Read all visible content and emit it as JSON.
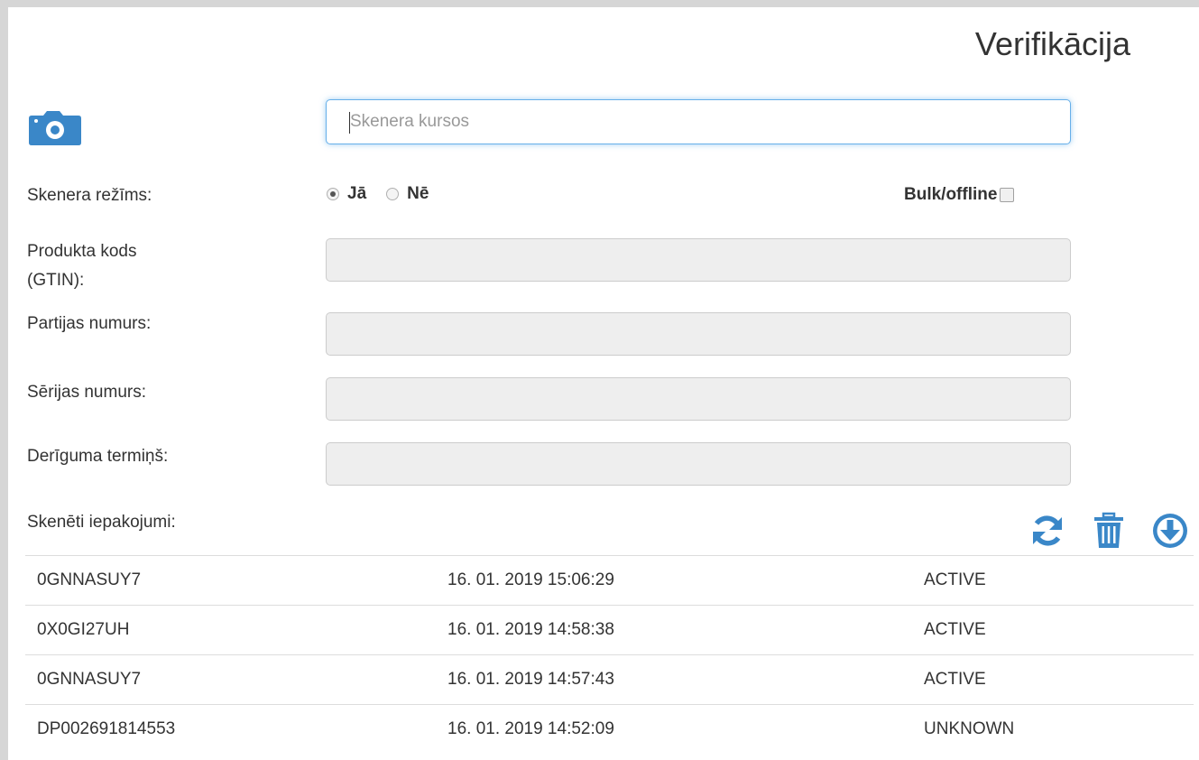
{
  "page": {
    "title": "Verifikācija"
  },
  "scanner": {
    "camera_icon": "camera-icon",
    "cursor_placeholder": "Skenera kursos"
  },
  "mode": {
    "label": "Skenera režīms:",
    "options": [
      {
        "label": "Jā",
        "selected": true
      },
      {
        "label": "Nē",
        "selected": false
      }
    ],
    "bulk_label": "Bulk/offline",
    "bulk_checked": false
  },
  "fields": [
    {
      "label_line1": "Produkta kods",
      "label_line2": "(GTIN):",
      "value": ""
    },
    {
      "label_line1": "Partijas numurs:",
      "value": ""
    },
    {
      "label_line1": "Sērijas numurs:",
      "value": ""
    },
    {
      "label_line1": "Derīguma termiņš:",
      "value": ""
    }
  ],
  "packages": {
    "label": "Skenēti iepakojumi:",
    "icons": [
      "refresh-icon",
      "trash-icon",
      "download-icon"
    ],
    "rows": [
      {
        "code": "0GNNASUY7",
        "datetime": "16. 01. 2019 15:06:29",
        "status": "ACTIVE"
      },
      {
        "code": "0X0GI27UH",
        "datetime": "16. 01. 2019 14:58:38",
        "status": "ACTIVE"
      },
      {
        "code": "0GNNASUY7",
        "datetime": "16. 01. 2019 14:57:43",
        "status": "ACTIVE"
      },
      {
        "code": "DP002691814553",
        "datetime": "16. 01. 2019 14:52:09",
        "status": "UNKNOWN"
      }
    ]
  },
  "colors": {
    "accent": "#3a87c8",
    "focus_border": "#66afe9",
    "disabled_field": "#eeeeee"
  }
}
